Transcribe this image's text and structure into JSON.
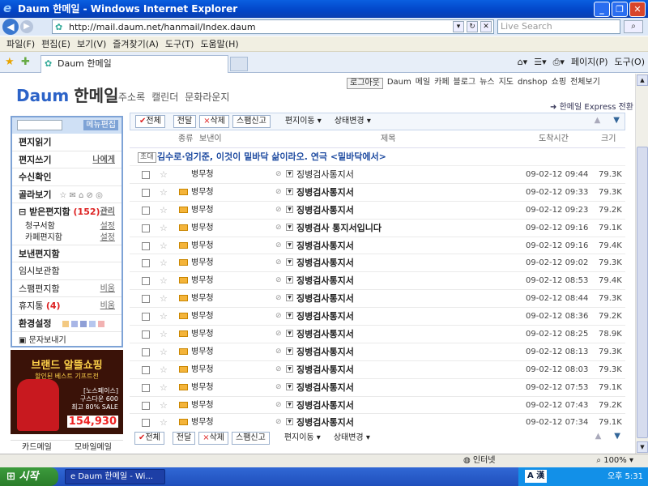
{
  "window": {
    "title": "Daum 한메일 - Windows Internet Explorer"
  },
  "address": {
    "url": "http://mail.daum.net/hanmail/Index.daum",
    "search_placeholder": "Live Search"
  },
  "menu": [
    "파일(F)",
    "편집(E)",
    "보기(V)",
    "즐겨찾기(A)",
    "도구(T)",
    "도움말(H)"
  ],
  "tab": {
    "title": "Daum 한메일"
  },
  "toolbar_right": {
    "page": "페이지(P)",
    "tools": "도구(O)"
  },
  "gnb": {
    "logout": "로그아웃",
    "links": [
      "Daum",
      "메일",
      "카페",
      "블로그",
      "뉴스",
      "지도",
      "dnshop",
      "쇼핑",
      "전체보기"
    ]
  },
  "logo": {
    "brand": "Daum",
    "service": "한메일"
  },
  "gnb2": [
    "주소록",
    "캘린더",
    "문화라운지"
  ],
  "express": "한메일 Express 전환",
  "sidebar": {
    "edit_label": "메뉴편집",
    "read": "편지읽기",
    "write": "편지쓰기",
    "write_me": "나에게",
    "receipt": "수신확인",
    "filter": "골라보기",
    "inbox": "받은편지함",
    "inbox_count": "(152)",
    "manage": "관리",
    "sub1": "청구서함",
    "sub2": "카페편지함",
    "settings_link": "설정",
    "sent": "보낸편지함",
    "temp": "임시보관함",
    "spam": "스팸편지함",
    "trash": "휴지통",
    "trash_count": "(4)",
    "empty": "비움",
    "env": "환경설정",
    "sms": "문자보내기",
    "env_colors": [
      "#f3c982",
      "#a8b6e6",
      "#8f9fd6",
      "#b6c6ee",
      "#f2b2b2"
    ]
  },
  "ad": {
    "title": "브랜드 알뜰쇼핑",
    "sub": "할인된 베스트 기프트전",
    "brand": "[노스페이스]",
    "desc1": "구스다운 600",
    "desc2": "최고 80% SALE",
    "price": "154,930"
  },
  "sidebar_bottom": [
    "카드메일",
    "모바일메일"
  ],
  "mail_toolbar": {
    "all": "전체",
    "reply": "전달",
    "delete": "삭제",
    "spam": "스팸신고",
    "move": "편지이동",
    "status": "상태변경"
  },
  "columns": {
    "type": "종류",
    "sender": "보낸이",
    "subject": "제목",
    "date": "도착시간",
    "size": "크기"
  },
  "notice": {
    "badge": "초대",
    "text": "김수로·엄기준, 이것이 밑바닥 삶이라오. 연극 <밑바닥에서>"
  },
  "messages": [
    {
      "sender": "병무청",
      "subject": "징병검사통지서",
      "date": "09-02-12 09:44",
      "size": "79.3K",
      "unread": false
    },
    {
      "sender": "병무청",
      "subject": "징병검사통지서",
      "date": "09-02-12 09:33",
      "size": "79.3K",
      "unread": true
    },
    {
      "sender": "병무청",
      "subject": "징병검사통지서",
      "date": "09-02-12 09:23",
      "size": "79.2K",
      "unread": true
    },
    {
      "sender": "병무청",
      "subject": "징병검사 통지서입니다",
      "date": "09-02-12 09:16",
      "size": "79.1K",
      "unread": true
    },
    {
      "sender": "병무청",
      "subject": "징병검사통지서",
      "date": "09-02-12 09:16",
      "size": "79.4K",
      "unread": true
    },
    {
      "sender": "병무청",
      "subject": "징병검사통지서",
      "date": "09-02-12 09:02",
      "size": "79.3K",
      "unread": true
    },
    {
      "sender": "병무청",
      "subject": "징병검사통지서",
      "date": "09-02-12 08:53",
      "size": "79.4K",
      "unread": true
    },
    {
      "sender": "병무청",
      "subject": "징병검사통지서",
      "date": "09-02-12 08:44",
      "size": "79.3K",
      "unread": true
    },
    {
      "sender": "병무청",
      "subject": "징병검사통지서",
      "date": "09-02-12 08:36",
      "size": "79.2K",
      "unread": true
    },
    {
      "sender": "병무청",
      "subject": "징병검사통지서",
      "date": "09-02-12 08:25",
      "size": "78.9K",
      "unread": true
    },
    {
      "sender": "병무청",
      "subject": "징병검사통지서",
      "date": "09-02-12 08:13",
      "size": "79.3K",
      "unread": true
    },
    {
      "sender": "병무청",
      "subject": "징병검사통지서",
      "date": "09-02-12 08:03",
      "size": "79.3K",
      "unread": true
    },
    {
      "sender": "병무청",
      "subject": "징병검사통지서",
      "date": "09-02-12 07:53",
      "size": "79.1K",
      "unread": true
    },
    {
      "sender": "병무청",
      "subject": "징병검사통지서",
      "date": "09-02-12 07:43",
      "size": "79.2K",
      "unread": true
    },
    {
      "sender": "병무청",
      "subject": "징병검사통지서",
      "date": "09-02-12 07:34",
      "size": "79.1K",
      "unread": true
    }
  ],
  "status": {
    "zone": "인터넷",
    "zoom": "100%"
  },
  "taskbar": {
    "start": "시작",
    "task": "Daum 한메일 - Wi...",
    "ime": "A 漢",
    "clock": "오후 5:31"
  }
}
